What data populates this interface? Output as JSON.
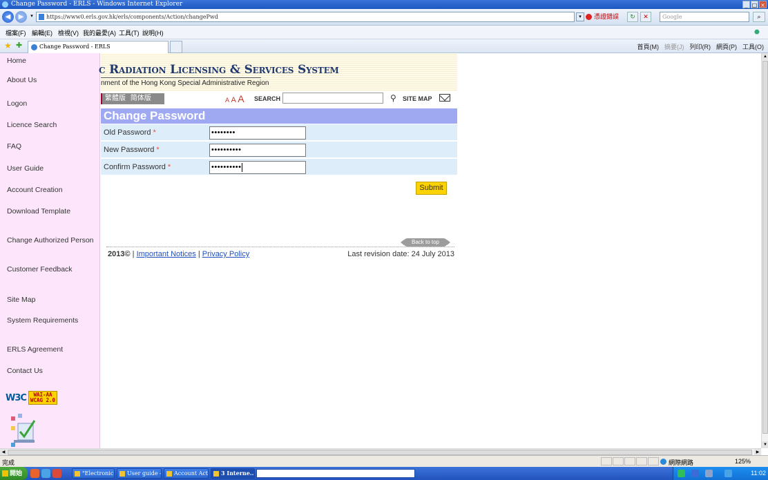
{
  "window": {
    "title": "Change Password - ERLS - Windows Internet Explorer"
  },
  "browser": {
    "url": "https://www0.erls.gov.hk/erls/components/Action/changePwd",
    "cert_error": "憑證錯誤",
    "search_placeholder": "Google",
    "menu": [
      "檔案(F)",
      "編輯(E)",
      "檢視(V)",
      "我的最愛(A)",
      "工具(T)",
      "說明(H)"
    ],
    "tab_title": "Change Password - ERLS",
    "command_bar": [
      "首頁(M)",
      "摘要(J)",
      "列印(R)",
      "網頁(P)",
      "工具(O)"
    ]
  },
  "sidebar": {
    "items": [
      "Home",
      "About Us",
      "Logon",
      "Licence Search",
      "FAQ",
      "User Guide",
      "Account Creation",
      "Download Template",
      "Change Authorized Person",
      "Customer Feedback",
      "Site Map",
      "System Requirements",
      "ERLS Agreement",
      "Contact Us"
    ],
    "badge": {
      "w3c": "W3C",
      "wcag_line1": "WAI-AA",
      "wcag_line2": "WCAG 2.0"
    }
  },
  "header": {
    "system_title": "c Radiation Licensing & Services System",
    "subtitle": "nment of the Hong Kong Special Administrative Region",
    "lang_traditional": "繁體版",
    "lang_simplified": "简体版",
    "font_a_small": "A",
    "font_a_medium": "A",
    "font_a_large": "A",
    "search_label": "SEARCH",
    "site_map": "SITE MAP"
  },
  "form": {
    "title": "Change Password",
    "fields": [
      {
        "label": "Old Password",
        "required_mark": "*",
        "value": "••••••••"
      },
      {
        "label": "New Password",
        "required_mark": "*",
        "value": "••••••••••"
      },
      {
        "label": "Confirm Password",
        "required_mark": "*",
        "value": "••••••••••"
      }
    ],
    "submit_label": "Submit"
  },
  "footer": {
    "back_to_top": "Back to top",
    "copyright": "2013©",
    "separator": "|",
    "important_notices": "Important Notices",
    "privacy_policy": "Privacy Policy",
    "last_revision": "Last revision date: 24 July 2013"
  },
  "statusbar": {
    "status": "完成",
    "zone": "網際網路",
    "zoom": "125%"
  },
  "taskbar": {
    "start": "開始",
    "buttons": [
      "\"Electronic ...",
      "User guide - ...",
      "Account Acti...",
      "3 Interne..."
    ],
    "clock": "11:02"
  },
  "colors": {
    "sidebar_bg": "#fde6fb",
    "form_title_bg": "#9fa9f2",
    "form_row_bg": "#deedfa",
    "submit_bg": "#fcd200",
    "link": "#1f4fbf",
    "title_text": "#1f3870"
  }
}
